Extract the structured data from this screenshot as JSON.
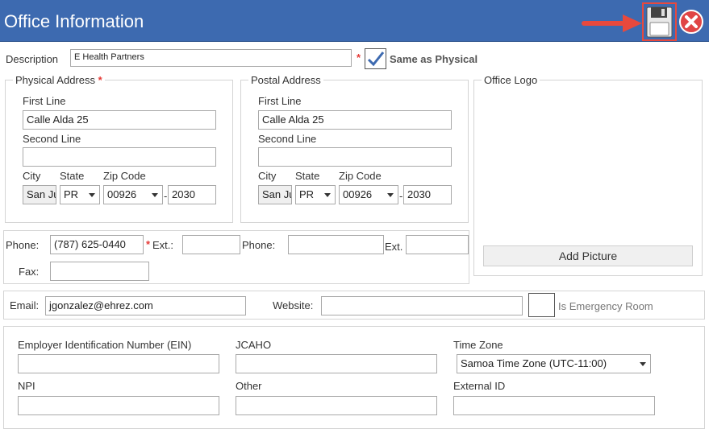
{
  "title": "Office Information",
  "toolbar": {
    "save_icon": "save-icon",
    "close_icon": "close-icon"
  },
  "description": {
    "label": "Description",
    "value": "E Health Partners",
    "required_mark": "*",
    "same_as_physical": "Same as Physical"
  },
  "physical": {
    "legend": "Physical Address",
    "required_mark": "*",
    "first_line_label": "First Line",
    "first_line": "Calle Alda 25",
    "second_line_label": "Second Line",
    "second_line": "",
    "city_label": "City",
    "city": "San Ju",
    "state_label": "State",
    "state": "PR",
    "zip_label": "Zip Code",
    "zip": "00926",
    "dash": "-",
    "zip_ext": "2030"
  },
  "postal": {
    "legend": "Postal Address",
    "first_line_label": "First Line",
    "first_line": "Calle Alda 25",
    "second_line_label": "Second Line",
    "second_line": "",
    "city_label": "City",
    "city": "San Ju",
    "state_label": "State",
    "state": "PR",
    "zip_label": "Zip Code",
    "zip": "00926",
    "dash": "-",
    "zip_ext": "2030"
  },
  "logo": {
    "legend": "Office Logo",
    "add_picture": "Add Picture"
  },
  "phones": {
    "phone1_label": "Phone:",
    "phone1": "(787) 625-0440",
    "required_mark": "*",
    "ext1_label": "Ext.:",
    "ext1": "",
    "phone2_label": "Phone:",
    "phone2": "",
    "ext2_label": "Ext.",
    "ext2": "",
    "fax_label": "Fax:",
    "fax": ""
  },
  "contact": {
    "email_label": "Email:",
    "email": "jgonzalez@ehrez.com",
    "website_label": "Website:",
    "website": "",
    "emergency_label": "Is Emergency Room"
  },
  "ids": {
    "ein_label": "Employer Identification Number (EIN)",
    "ein": "",
    "jcaho_label": "JCAHO",
    "jcaho": "",
    "timezone_label": "Time Zone",
    "timezone": "Samoa Time Zone (UTC-11:00)",
    "npi_label": "NPI",
    "npi": "",
    "other_label": "Other",
    "other": "",
    "external_label": "External ID",
    "external": ""
  },
  "colors": {
    "titlebar": "#3d6ab0",
    "required": "#e53935",
    "annotation": "#e8493d"
  }
}
